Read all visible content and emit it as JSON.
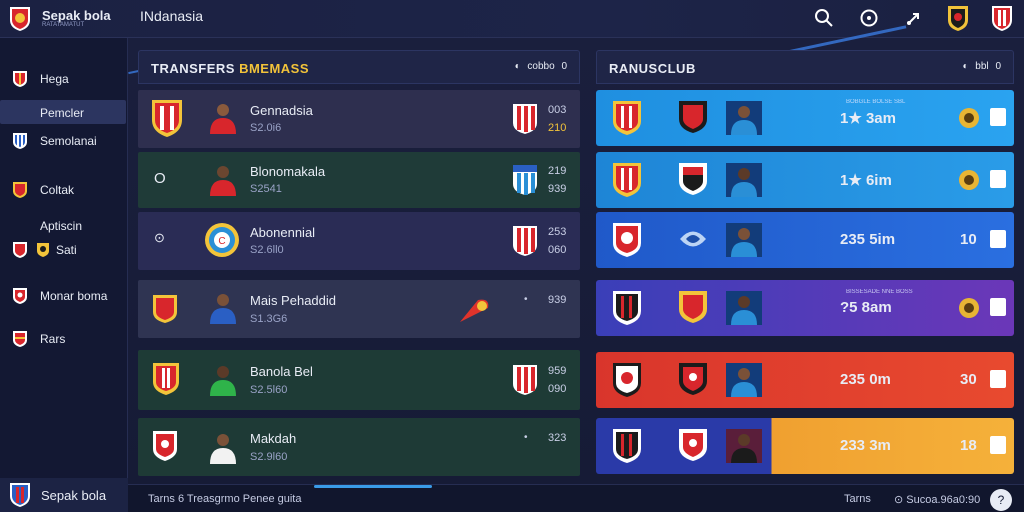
{
  "app": {
    "title": "Sepak bola",
    "subtitle": "RATATAMATUT",
    "region": "INdanasia"
  },
  "icons": [
    "search-icon",
    "target-icon",
    "share-icon",
    "profile-crest-icon",
    "club-crest-icon"
  ],
  "sidebar": {
    "items": [
      {
        "label": "Hega",
        "crest": "crest-red"
      },
      {
        "label": "Pemcler",
        "active": true
      },
      {
        "label": "Semolanai",
        "crest": "crest-blue"
      },
      {
        "label": "Coltak",
        "crest": "crest-red"
      },
      {
        "label": "Aptiscin",
        "crest": "crest-red"
      },
      {
        "label": "Sati",
        "crest": "crest-gold"
      },
      {
        "label": "Monar boma",
        "crest": "crest-red"
      },
      {
        "label": "Rars",
        "crest": "crest-red"
      }
    ],
    "bottom_label": "Sepak bola"
  },
  "transfers": {
    "title": "TRANSFERS",
    "title_accent": "BMEMASS",
    "control": "cobbo",
    "control_value": "0",
    "rows": [
      {
        "name": "Gennadsia",
        "value": "S2.0i6",
        "n1": "003",
        "n2": "210",
        "n2_color": "#f2c33a",
        "bg": "#2e2f4f",
        "lead": ""
      },
      {
        "name": "Blonomakala",
        "value": "S2541",
        "n1": "219",
        "n2": "939",
        "bg": "#1f3b38",
        "lead": "O"
      },
      {
        "name": "Abonennial",
        "value": "S2.6ll0",
        "n1": "253",
        "n2": "060",
        "bg": "#2a2c55",
        "lead": "⊙"
      },
      {
        "name": "Mais Pehaddid",
        "value": "S1.3G6",
        "n1": "939",
        "n2": "",
        "bg": "#2f3452",
        "lead": ""
      },
      {
        "name": "Banola Bel",
        "value": "S2.5l60",
        "n1": "959",
        "n2": "090",
        "bg": "#1e3b36",
        "lead": ""
      },
      {
        "name": "Makdah",
        "value": "S2.9l60",
        "n1": "323",
        "n2": "",
        "bg": "#1e3a36",
        "lead": ""
      }
    ]
  },
  "ranking": {
    "title": "RANUSCLUB",
    "control": "bbl",
    "control_value": "0",
    "rows": [
      {
        "tiny": "BOBGLE BOLSE SBL",
        "value": "1★ 3am",
        "rank_type": "gold-badge",
        "bg": "#1f8fe0"
      },
      {
        "tiny": "",
        "value": "1★ 6im",
        "rank_type": "gold-badge",
        "bg": "#1e85d6"
      },
      {
        "tiny": "",
        "value": "235 5im",
        "rank_type": "10",
        "bg": "#2059c9"
      },
      {
        "tiny": "BISSESADE NNE BOSS",
        "value": "?5 8am",
        "rank_type": "gold-badge",
        "bg": "#5a39b8"
      },
      {
        "tiny": "",
        "value": "235 0m",
        "rank_type": "30",
        "bg": "#d9352c"
      },
      {
        "tiny": "",
        "value": "233 3m",
        "rank_type": "18",
        "bg": "#f0a030"
      }
    ]
  },
  "footer": {
    "left": "Tarns 6 Treasgrmo Penee guita",
    "right_label": "Tarns",
    "right_value": "Sucoa.96a0:90"
  }
}
